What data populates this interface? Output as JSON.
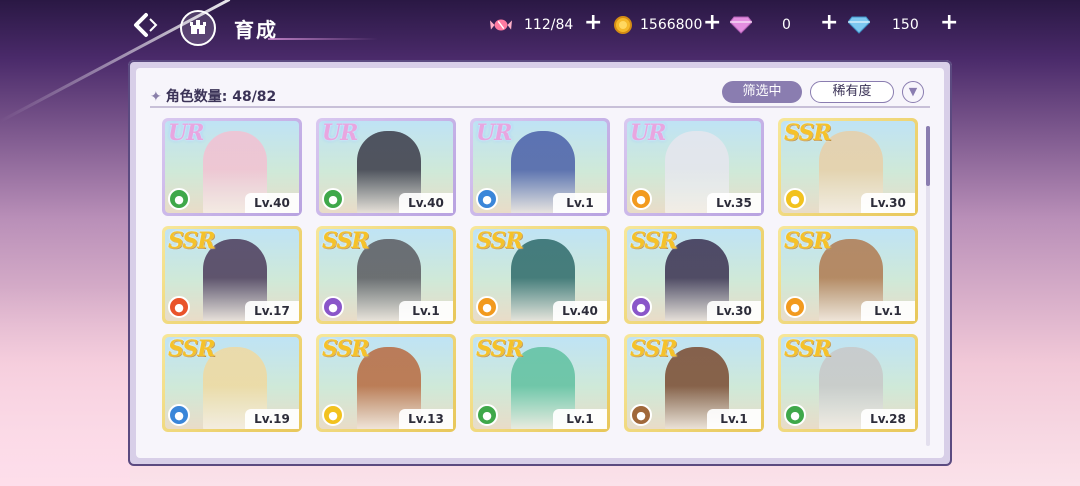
{
  "header": {
    "title": "育成",
    "back_icon": "back-arrow-icon",
    "home_icon": "castle-icon"
  },
  "resources": [
    {
      "name": "candy",
      "icon": "candy-icon",
      "value": "112/84",
      "color": "#ff7aa0"
    },
    {
      "name": "gold",
      "icon": "coin-icon",
      "value": "1566800",
      "color": "#f5b92a"
    },
    {
      "name": "pink-gem",
      "icon": "pink-diamond-icon",
      "value": "0",
      "color": "#e38ee0"
    },
    {
      "name": "blue-gem",
      "icon": "blue-diamond-icon",
      "value": "150",
      "color": "#7ec8f0"
    }
  ],
  "panel": {
    "count_label": "角色数量: 48/82",
    "filter_label": "筛选中",
    "sort_label": "稀有度",
    "sort_dir_icon": "chevron-down-icon"
  },
  "cards": [
    {
      "rarity": "UR",
      "level": "Lv.40",
      "attr_color": "#3fa84a",
      "figure": "#f3c1d2"
    },
    {
      "rarity": "UR",
      "level": "Lv.40",
      "attr_color": "#3fa84a",
      "figure": "#3a3a48"
    },
    {
      "rarity": "UR",
      "level": "Lv.1",
      "attr_color": "#3a86d9",
      "figure": "#4a5fa8"
    },
    {
      "rarity": "UR",
      "level": "Lv.35",
      "attr_color": "#f29a1e",
      "figure": "#e6e6ee"
    },
    {
      "rarity": "SSR",
      "level": "Lv.30",
      "attr_color": "#f2c21e",
      "figure": "#e8cfa8"
    },
    {
      "rarity": "SSR",
      "level": "Lv.17",
      "attr_color": "#e9532a",
      "figure": "#4b3a5a"
    },
    {
      "rarity": "SSR",
      "level": "Lv.1",
      "attr_color": "#8a56c9",
      "figure": "#5a5a60"
    },
    {
      "rarity": "SSR",
      "level": "Lv.40",
      "attr_color": "#f29a1e",
      "figure": "#2e6a6a"
    },
    {
      "rarity": "SSR",
      "level": "Lv.30",
      "attr_color": "#8a56c9",
      "figure": "#3a3050"
    },
    {
      "rarity": "SSR",
      "level": "Lv.1",
      "attr_color": "#f29a1e",
      "figure": "#b07a50"
    },
    {
      "rarity": "SSR",
      "level": "Lv.19",
      "attr_color": "#3a86d9",
      "figure": "#f0d9a0"
    },
    {
      "rarity": "SSR",
      "level": "Lv.13",
      "attr_color": "#f2c21e",
      "figure": "#b86a40"
    },
    {
      "rarity": "SSR",
      "level": "Lv.1",
      "attr_color": "#3fa84a",
      "figure": "#5fc0a0"
    },
    {
      "rarity": "SSR",
      "level": "Lv.1",
      "attr_color": "#a0683a",
      "figure": "#7a4a30"
    },
    {
      "rarity": "SSR",
      "level": "Lv.28",
      "attr_color": "#3fa84a",
      "figure": "#c8c8c8"
    }
  ]
}
